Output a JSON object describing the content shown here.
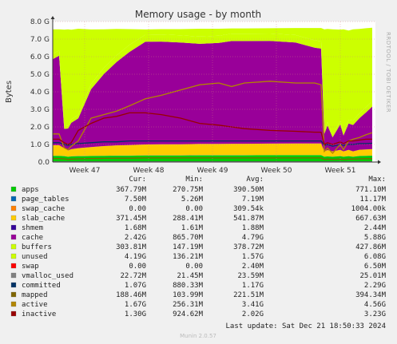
{
  "header": {
    "title": "Memory usage - by month",
    "side_text": "RRDTOOL / TOBI OETIKER",
    "footer": "Munin 2.0.57"
  },
  "legend": {
    "headers": [
      "Cur:",
      "Min:",
      "Avg:",
      "Max:"
    ],
    "rows": [
      {
        "name": "apps",
        "color": "#00cc00",
        "cur": "367.79M",
        "min": "270.75M",
        "avg": "390.50M",
        "max": "771.10M"
      },
      {
        "name": "page_tables",
        "color": "#0066b3",
        "cur": "7.50M",
        "min": "5.26M",
        "avg": "7.19M",
        "max": "11.17M"
      },
      {
        "name": "swap_cache",
        "color": "#ff8000",
        "cur": "0.00",
        "min": "0.00",
        "avg": "309.54k",
        "max": "1004.00k"
      },
      {
        "name": "slab_cache",
        "color": "#ffcc00",
        "cur": "371.45M",
        "min": "288.41M",
        "avg": "541.87M",
        "max": "667.63M"
      },
      {
        "name": "shmem",
        "color": "#330099",
        "cur": "1.68M",
        "min": "1.61M",
        "avg": "1.88M",
        "max": "2.44M"
      },
      {
        "name": "cache",
        "color": "#990099",
        "cur": "2.42G",
        "min": "865.70M",
        "avg": "4.79G",
        "max": "5.88G"
      },
      {
        "name": "buffers",
        "color": "#ccff00",
        "cur": "303.81M",
        "min": "147.19M",
        "avg": "378.72M",
        "max": "427.86M"
      },
      {
        "name": "unused",
        "color": "#ccff00",
        "cur": "4.19G",
        "min": "136.21M",
        "avg": "1.57G",
        "max": "6.08G"
      },
      {
        "name": "swap",
        "color": "#ff0000",
        "cur": "0.00",
        "min": "0.00",
        "avg": "2.40M",
        "max": "6.50M"
      },
      {
        "name": "vmalloc_used",
        "color": "#808080",
        "cur": "22.72M",
        "min": "21.45M",
        "avg": "23.59M",
        "max": "25.01M"
      },
      {
        "name": "committed",
        "color": "#003366",
        "cur": "1.07G",
        "min": "880.33M",
        "avg": "1.17G",
        "max": "2.29G"
      },
      {
        "name": "mapped",
        "color": "#806600",
        "cur": "188.46M",
        "min": "103.99M",
        "avg": "221.51M",
        "max": "394.34M"
      },
      {
        "name": "active",
        "color": "#b38600",
        "cur": "1.67G",
        "min": "256.31M",
        "avg": "3.41G",
        "max": "4.56G"
      },
      {
        "name": "inactive",
        "color": "#990000",
        "cur": "1.30G",
        "min": "924.62M",
        "avg": "2.02G",
        "max": "3.23G"
      }
    ],
    "last_update": "Last update:  Sat Dec 21 18:50:33 2024"
  },
  "chart_data": {
    "type": "area",
    "title": "Memory usage - by month",
    "ylabel": "Bytes",
    "y_unit": "bytes (G = 2^30)",
    "ylim": [
      0,
      8
    ],
    "y_ticks": [
      "0.0",
      "1.0 G",
      "2.0 G",
      "3.0 G",
      "4.0 G",
      "5.0 G",
      "6.0 G",
      "7.0 G",
      "8.0 G"
    ],
    "x_ticks": [
      "Week 47",
      "Week 48",
      "Week 49",
      "Week 50",
      "Week 51"
    ],
    "x_tick_positions_in_weeks": [
      0.5,
      1.5,
      2.5,
      3.5,
      4.5
    ],
    "x_range_weeks": [
      0,
      5.05
    ],
    "x_points_weeks": [
      0,
      0.1,
      0.18,
      0.24,
      0.29,
      0.4,
      0.6,
      0.8,
      1.0,
      1.2,
      1.45,
      1.7,
      2.0,
      2.3,
      2.6,
      2.8,
      3.0,
      3.4,
      3.8,
      4.1,
      4.2,
      4.25,
      4.3,
      4.38,
      4.5,
      4.55,
      4.63,
      4.7,
      4.8,
      4.9,
      5.0
    ],
    "stacked_series": [
      {
        "name": "apps",
        "color": "#00cc00",
        "values": [
          0.35,
          0.35,
          0.33,
          0.3,
          0.32,
          0.33,
          0.34,
          0.35,
          0.36,
          0.36,
          0.37,
          0.37,
          0.37,
          0.38,
          0.38,
          0.38,
          0.38,
          0.39,
          0.39,
          0.39,
          0.39,
          0.3,
          0.32,
          0.3,
          0.33,
          0.3,
          0.33,
          0.3,
          0.34,
          0.35,
          0.36
        ]
      },
      {
        "name": "page_tables",
        "color": "#0066b3",
        "values": [
          0.01,
          0.01,
          0.01,
          0.01,
          0.01,
          0.01,
          0.01,
          0.01,
          0.01,
          0.01,
          0.01,
          0.01,
          0.01,
          0.01,
          0.01,
          0.01,
          0.01,
          0.01,
          0.01,
          0.01,
          0.01,
          0.01,
          0.01,
          0.01,
          0.01,
          0.01,
          0.01,
          0.01,
          0.01,
          0.01,
          0.01
        ]
      },
      {
        "name": "swap_cache",
        "color": "#ff8000",
        "values": [
          0,
          0,
          0,
          0,
          0,
          0,
          0,
          0,
          0,
          0,
          0,
          0,
          0,
          0,
          0,
          0,
          0,
          0,
          0,
          0,
          0,
          0,
          0,
          0,
          0,
          0,
          0,
          0,
          0,
          0,
          0
        ]
      },
      {
        "name": "slab_cache",
        "color": "#ffcc00",
        "values": [
          0.6,
          0.6,
          0.45,
          0.35,
          0.4,
          0.45,
          0.5,
          0.55,
          0.58,
          0.6,
          0.62,
          0.63,
          0.63,
          0.64,
          0.64,
          0.65,
          0.65,
          0.65,
          0.66,
          0.66,
          0.66,
          0.3,
          0.35,
          0.3,
          0.35,
          0.3,
          0.35,
          0.3,
          0.35,
          0.36,
          0.37
        ]
      },
      {
        "name": "shmem",
        "color": "#330099",
        "values": [
          0,
          0,
          0,
          0,
          0,
          0,
          0,
          0,
          0,
          0,
          0,
          0,
          0,
          0,
          0,
          0,
          0,
          0,
          0,
          0,
          0,
          0,
          0,
          0,
          0,
          0,
          0,
          0,
          0,
          0,
          0
        ]
      },
      {
        "name": "cache",
        "color": "#990099",
        "values": [
          4.9,
          5.1,
          1.1,
          1.25,
          1.5,
          1.7,
          3.3,
          4.1,
          4.75,
          5.3,
          5.85,
          5.85,
          5.8,
          5.7,
          5.75,
          5.85,
          5.85,
          5.85,
          5.75,
          5.45,
          5.4,
          1.0,
          1.4,
          0.8,
          1.45,
          0.9,
          1.5,
          1.5,
          1.8,
          2.1,
          2.42
        ]
      },
      {
        "name": "buffers",
        "color": "#ccff00",
        "values": [
          0.3,
          0.3,
          0.15,
          0.15,
          0.2,
          0.2,
          0.3,
          0.35,
          0.38,
          0.4,
          0.4,
          0.41,
          0.41,
          0.41,
          0.41,
          0.42,
          0.42,
          0.42,
          0.42,
          0.42,
          0.42,
          0.15,
          0.2,
          0.15,
          0.2,
          0.15,
          0.2,
          0.25,
          0.28,
          0.3,
          0.3
        ]
      },
      {
        "name": "unused",
        "color": "#ccff00",
        "values": [
          1.4,
          1.2,
          5.5,
          5.5,
          5.1,
          4.9,
          3.1,
          2.2,
          1.5,
          0.9,
          0.3,
          0.3,
          0.35,
          0.45,
          0.4,
          0.3,
          0.3,
          0.3,
          0.4,
          0.7,
          0.75,
          5.8,
          5.3,
          6.0,
          5.2,
          5.9,
          5.1,
          5.2,
          4.8,
          4.5,
          4.19
        ]
      },
      {
        "name": "swap",
        "color": "#ff0000",
        "values": [
          0,
          0,
          0,
          0,
          0,
          0,
          0,
          0,
          0,
          0,
          0,
          0,
          0,
          0,
          0,
          0,
          0,
          0,
          0,
          0,
          0,
          0,
          0,
          0,
          0,
          0,
          0,
          0,
          0,
          0,
          0
        ]
      }
    ],
    "line_series": [
      {
        "name": "vmalloc_used",
        "color": "#808080",
        "values": [
          0.02,
          0.02,
          0.02,
          0.02,
          0.02,
          0.02,
          0.02,
          0.02,
          0.02,
          0.02,
          0.02,
          0.02,
          0.02,
          0.02,
          0.02,
          0.02,
          0.02,
          0.02,
          0.02,
          0.02,
          0.02,
          0.02,
          0.02,
          0.02,
          0.02,
          0.02,
          0.02,
          0.02,
          0.02,
          0.02,
          0.02
        ]
      },
      {
        "name": "committed",
        "color": "#003366",
        "values": [
          1.1,
          1.1,
          1.0,
          0.95,
          1.0,
          1.05,
          1.1,
          1.15,
          1.15,
          1.2,
          1.2,
          1.2,
          1.2,
          1.2,
          1.2,
          1.2,
          1.2,
          1.2,
          1.2,
          1.2,
          1.2,
          0.95,
          1.0,
          0.9,
          1.0,
          0.95,
          1.0,
          1.0,
          1.05,
          1.05,
          1.07
        ]
      },
      {
        "name": "mapped",
        "color": "#806600",
        "values": [
          0.2,
          0.2,
          0.18,
          0.15,
          0.17,
          0.18,
          0.2,
          0.21,
          0.22,
          0.22,
          0.23,
          0.23,
          0.23,
          0.23,
          0.23,
          0.23,
          0.23,
          0.23,
          0.23,
          0.23,
          0.23,
          0.15,
          0.17,
          0.15,
          0.17,
          0.15,
          0.17,
          0.17,
          0.18,
          0.19,
          0.19
        ]
      },
      {
        "name": "active",
        "color": "#b38600",
        "values": [
          1.6,
          1.6,
          0.8,
          0.7,
          0.9,
          1.2,
          2.5,
          2.7,
          2.9,
          3.2,
          3.6,
          3.8,
          4.1,
          4.4,
          4.5,
          4.3,
          4.5,
          4.6,
          4.5,
          4.5,
          4.4,
          0.6,
          0.8,
          0.5,
          1.0,
          0.7,
          1.2,
          1.3,
          1.4,
          1.55,
          1.67
        ]
      },
      {
        "name": "inactive",
        "color": "#990000",
        "values": [
          1.3,
          1.3,
          1.1,
          1.0,
          1.1,
          1.8,
          2.2,
          2.5,
          2.6,
          2.8,
          2.8,
          2.7,
          2.5,
          2.2,
          2.1,
          2.0,
          1.9,
          1.8,
          1.75,
          1.7,
          1.7,
          1.0,
          1.1,
          1.0,
          1.15,
          1.05,
          1.2,
          1.2,
          1.25,
          1.3,
          1.3
        ]
      }
    ]
  }
}
